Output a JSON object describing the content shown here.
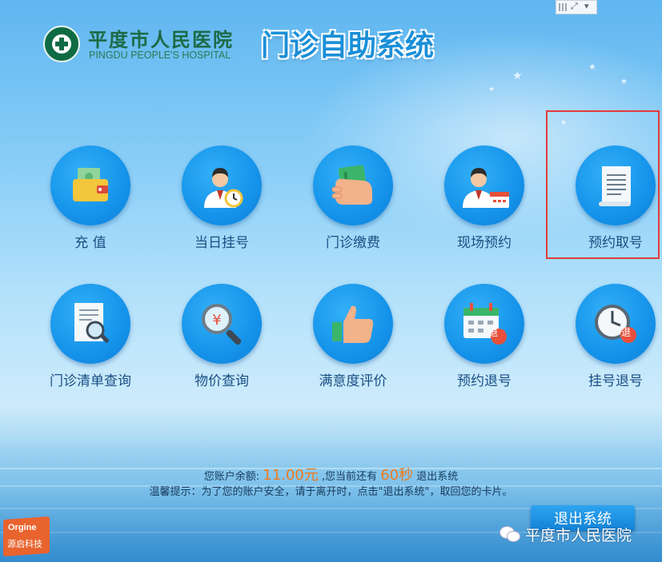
{
  "header": {
    "hospital_name_cn": "平度市人民医院",
    "hospital_name_en": "PINGDU PEOPLE'S HOSPITAL",
    "system_title": "门诊自助系统"
  },
  "menu": {
    "row1": [
      {
        "label": "充 值",
        "icon": "wallet-icon"
      },
      {
        "label": "当日挂号",
        "icon": "doctor-clock-icon"
      },
      {
        "label": "门诊缴费",
        "icon": "hand-card-icon"
      },
      {
        "label": "现场预约",
        "icon": "doctor-calendar-icon"
      },
      {
        "label": "预约取号",
        "icon": "ticket-scroll-icon"
      }
    ],
    "row2": [
      {
        "label": "门诊清单查询",
        "icon": "document-search-icon"
      },
      {
        "label": "物价查询",
        "icon": "price-magnifier-icon"
      },
      {
        "label": "满意度评价",
        "icon": "thumbs-up-icon"
      },
      {
        "label": "预约退号",
        "icon": "calendar-refund-icon"
      },
      {
        "label": "挂号退号",
        "icon": "clock-refund-icon"
      }
    ],
    "refund_badge": "退"
  },
  "footer": {
    "balance_prefix": "您账户余额:",
    "balance_amount": "11.00元",
    "balance_middle": ",您当前还有",
    "countdown": "60秒",
    "balance_suffix": "退出系统",
    "tip": "温馨提示：为了您的账户安全，请于离开时，点击\"退出系统\"，取回您的卡片。",
    "exit_button": "退出系统",
    "watermark": "平度市人民医院",
    "vendor_line1": "Orgine",
    "vendor_line2": "源启科技"
  },
  "colors": {
    "accent": "#1593ea",
    "amount": "#f07a1c",
    "highlight_border": "#e33b3b",
    "logo_green": "#1c6a45"
  }
}
